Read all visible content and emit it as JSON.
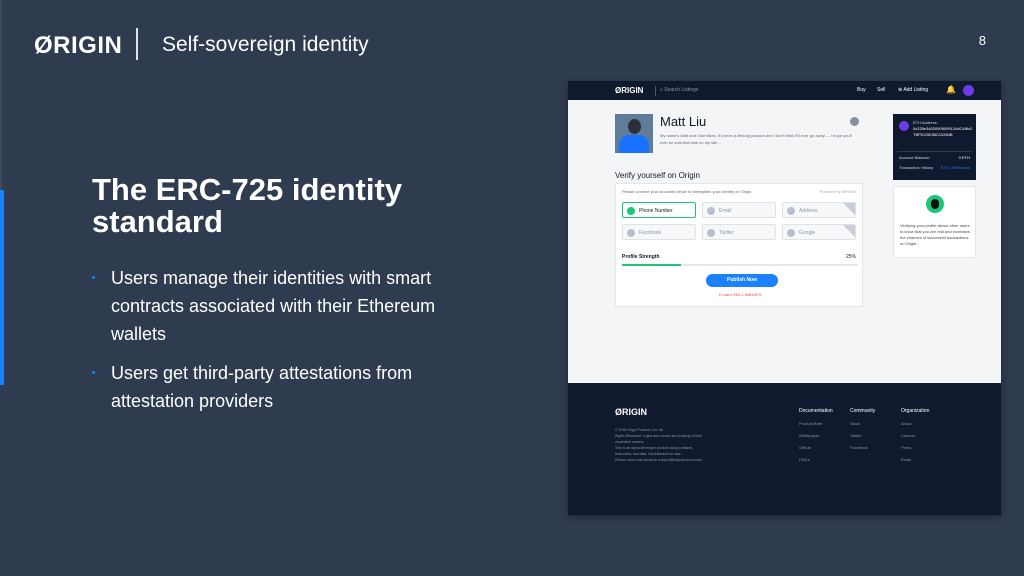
{
  "slide": {
    "brand": "ØRIGIN",
    "subtitle": "Self-sovereign identity",
    "page_number": "8",
    "headline": "The ERC-725 identity standard",
    "bullets": [
      "Users manage their identities with smart contracts associated with their Ethereum wallets",
      "Users get third-party attestations from attestation providers"
    ],
    "colors": {
      "background": "#2f3b4e",
      "accent": "#1a82ff"
    }
  },
  "screenshot": {
    "nav": {
      "logo": "ØRIGIN",
      "search_placeholder": "Search Listings",
      "buy": "Buy",
      "sell": "Sell",
      "add_listing": "Add Listing",
      "icons": [
        "search-icon",
        "plus-circle-icon",
        "bell-icon",
        "avatar-icon"
      ]
    },
    "profile": {
      "name": "Matt Liu",
      "bio": "My name's Matt and I like bikes. It's been a lifelong passion and I don't think it'll ever go away — I hope you'll ever be sold that bike on my site…"
    },
    "verify": {
      "title": "Verify yourself on Origin",
      "instruction": "Please connect your accounts below to strengthen your identity on Origin.",
      "powered_by": "Powered by ØRIGIN",
      "attestations": [
        {
          "label": "Phone Number",
          "verified": true
        },
        {
          "label": "Email",
          "verified": false
        },
        {
          "label": "Address",
          "verified": false
        },
        {
          "label": "Facebook",
          "verified": false
        },
        {
          "label": "Twitter",
          "verified": false
        },
        {
          "label": "Google",
          "verified": false
        }
      ],
      "strength_label": "Profile Strength",
      "strength_value": "25%",
      "strength_fraction": 0.25,
      "publish": "Publish Now",
      "footer_note": "To earn SKILL BADGES"
    },
    "wallet": {
      "label": "ETH Address:",
      "address": "0x225e34020909099124dC4f6c2TBFDC5D38C10284B",
      "balance_label": "Account Balance:",
      "balance_value": "0 ETH",
      "tx_label": "Transaction History",
      "tx_link": "ETH | Etherscan"
    },
    "tip": {
      "text": "Verifying your profile allows other users to know that you are real and increases the chances of successful transactions on Origin."
    },
    "footer": {
      "logo": "ØRIGIN",
      "copy": [
        "© 2018 Origin Protocol, Inc. All",
        "Rights Reserved. Logos and names are property of their",
        "respective owners.",
        "This is an alpha developer product using a testnet,",
        "beta coins, test data. Not intended for sale.",
        "Please report any issues to support@originprotocol.com"
      ],
      "columns": [
        {
          "heading": "Documentation",
          "items": [
            "Product Brief",
            "Whitepaper",
            "Github",
            "FAQ's"
          ]
        },
        {
          "heading": "Community",
          "items": [
            "Slack",
            "Twitter",
            "Facebook"
          ]
        },
        {
          "heading": "Organization",
          "items": [
            "About",
            "Careers",
            "Press",
            "Email"
          ]
        }
      ]
    }
  }
}
